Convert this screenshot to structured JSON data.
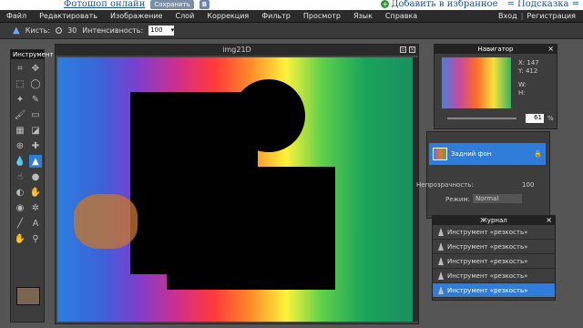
{
  "top": {
    "site_link": "Фотошоп онлайн",
    "save_button": "Сохранить",
    "vk_badge": "В",
    "add_fav": "Добавить в избранное",
    "hint": "= Подсказка ="
  },
  "menu": {
    "items": [
      "Файл",
      "Редактировать",
      "Изображение",
      "Слой",
      "Коррекция",
      "Фильтр",
      "Просмотр",
      "Язык",
      "Справка"
    ],
    "login": "Вход",
    "separator": "|",
    "register": "Регистрация"
  },
  "options": {
    "brush_label": "Кисть:",
    "brush_size": "30",
    "intensity_label": "Интенсивность:",
    "intensity_value": "100"
  },
  "toolbox": {
    "title": "Инструмент"
  },
  "document": {
    "title": "img21D"
  },
  "navigator": {
    "title": "Навигатор",
    "x_label": "X:",
    "x_value": "147",
    "y_label": "Y:",
    "y_value": "412",
    "w_label": "W:",
    "h_label": "H:",
    "zoom": "61",
    "zoom_unit": "%"
  },
  "layers": {
    "layer_name": "Задний фон",
    "opacity_label": "Непрозрачность:",
    "opacity_value": "100",
    "mode_label": "Режим:",
    "mode_value": "Normal"
  },
  "history": {
    "title": "Журнал",
    "items": [
      "Инструмент «резкость»",
      "Инструмент «резкость»",
      "Инструмент «резкость»",
      "Инструмент «резкость»",
      "Инструмент «резкость»"
    ]
  },
  "colors": {
    "accent": "#2f7dd8",
    "menubar": "#2b2b2b",
    "swatch": "#7a6550"
  }
}
